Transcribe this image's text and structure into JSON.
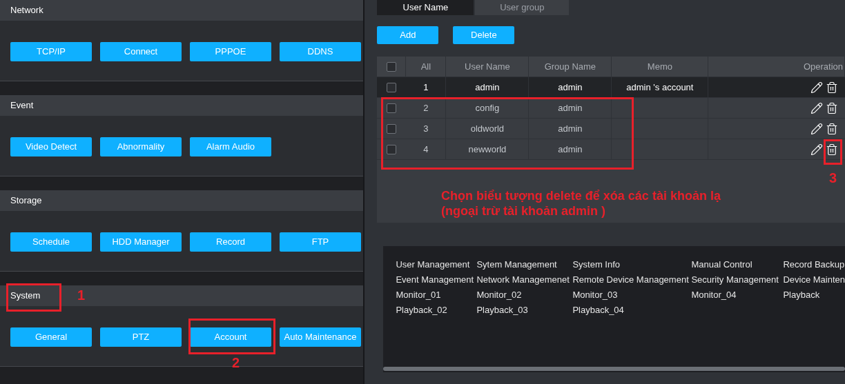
{
  "sections": [
    {
      "title": "Network",
      "buttons": [
        "TCP/IP",
        "Connect",
        "PPPOE",
        "DDNS"
      ]
    },
    {
      "title": "Event",
      "buttons": [
        "Video Detect",
        "Abnormality",
        "Alarm Audio"
      ]
    },
    {
      "title": "Storage",
      "buttons": [
        "Schedule",
        "HDD Manager",
        "Record",
        "FTP"
      ]
    },
    {
      "title": "System",
      "buttons": [
        "General",
        "PTZ",
        "Account",
        "Auto Maintenance"
      ]
    }
  ],
  "tabs": [
    {
      "label": "User Name",
      "selected": true
    },
    {
      "label": "User group",
      "selected": false
    }
  ],
  "actions": [
    "Add",
    "Delete"
  ],
  "table": {
    "header_checked": false,
    "columns": [
      "All",
      "User Name",
      "Group Name",
      "Memo",
      "Operation"
    ],
    "rows": [
      {
        "no": "1",
        "user": "admin",
        "group": "admin",
        "memo": "admin 's account",
        "checked": false,
        "selected": true
      },
      {
        "no": "2",
        "user": "config",
        "group": "admin",
        "checked": false,
        "selected": false
      },
      {
        "no": "3",
        "user": "oldworld",
        "group": "admin",
        "checked": false,
        "selected": false
      },
      {
        "no": "4",
        "user": "newworld",
        "group": "admin",
        "checked": false,
        "selected": false
      }
    ]
  },
  "permissions": [
    [
      "User Management",
      "Sytem Management",
      "System Info",
      "Manual Control",
      "Record Backup"
    ],
    [
      "Event Management",
      "Network Managemenet",
      "Remote Device Management",
      "Security Management",
      "Device Mainten"
    ],
    [
      "Monitor_01",
      "Monitor_02",
      "Monitor_03",
      "Monitor_04",
      "Playback"
    ],
    [
      "Playback_02",
      "Playback_03",
      "Playback_04"
    ]
  ],
  "annotations": {
    "markers": [
      "1",
      "2",
      "3"
    ],
    "caption": "Chọn biểu tượng delete để xóa các tài khoản lạ (ngoại trừ tài khoản admin )"
  }
}
